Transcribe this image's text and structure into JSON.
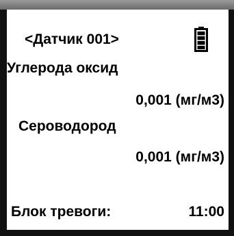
{
  "header": {
    "sensor_title": "<Датчик 001>",
    "battery_icon": "battery-full-icon"
  },
  "readings": [
    {
      "gas": "Углерода оксид",
      "value": "0,001 (мг/м3)"
    },
    {
      "gas": "Сероводород",
      "value": "0,001 (мг/м3)"
    }
  ],
  "footer": {
    "alarm_label": "Блок тревоги:",
    "time": "11:00"
  }
}
